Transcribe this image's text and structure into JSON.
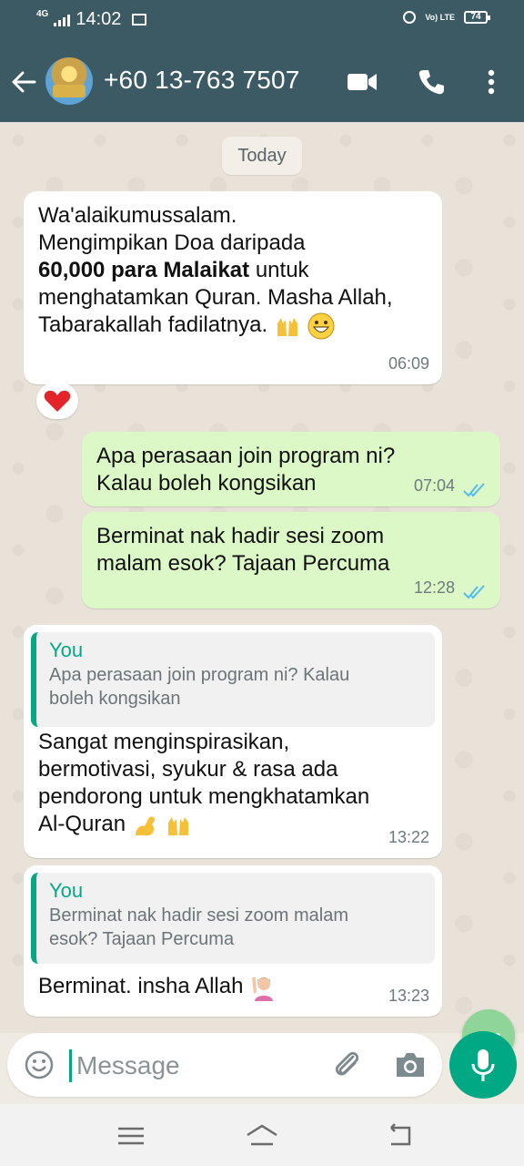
{
  "status_bar": {
    "network": "4G",
    "time": "14:02",
    "volte": "Vo) LTE",
    "battery": "74"
  },
  "header": {
    "contact": "+60 13-763 7507"
  },
  "chat": {
    "date_chip": "Today",
    "messages": [
      {
        "lines": [
          "Wa'alaikumussalam.",
          "Mengimpikan Doa daripada"
        ],
        "bold": "60,000 para Malaikat",
        "after_bold": " untuk",
        "lines2": [
          "menghatamkan Quran. Masha Allah,",
          "Tabarakallah fadilatnya."
        ],
        "time": "06:09",
        "reaction": "❤"
      },
      {
        "lines": [
          "Apa perasaan join program ni?",
          "Kalau boleh kongsikan"
        ],
        "time": "07:04"
      },
      {
        "lines": [
          "Berminat nak hadir sesi zoom",
          "malam esok? Tajaan Percuma"
        ],
        "time": "12:28"
      },
      {
        "quote_author": "You",
        "quote_text": [
          "Apa perasaan join program ni? Kalau",
          "boleh kongsikan"
        ],
        "lines": [
          "Sangat menginspirasikan,",
          "bermotivasi, syukur & rasa ada",
          "pendorong untuk mengkhatamkan",
          "Al-Quran"
        ],
        "time": "13:22"
      },
      {
        "quote_author": "You",
        "quote_text": [
          "Berminat nak hadir sesi zoom malam",
          "esok? Tajaan Percuma"
        ],
        "lines": [
          "Berminat. insha Allah"
        ],
        "time": "13:23"
      }
    ]
  },
  "composer": {
    "placeholder": "Message"
  },
  "colors": {
    "header": "#3b5a64",
    "outgoing_bubble": "#dcf8c6",
    "incoming_bubble": "#ffffff",
    "accent": "#00a884",
    "read_ticks": "#53bdeb"
  },
  "icons": [
    "back-arrow-icon",
    "video-call-icon",
    "phone-icon",
    "more-vert-icon",
    "emoji-icon",
    "attach-icon",
    "camera-icon",
    "mic-icon",
    "menu-icon",
    "home-icon",
    "back-nav-icon"
  ]
}
